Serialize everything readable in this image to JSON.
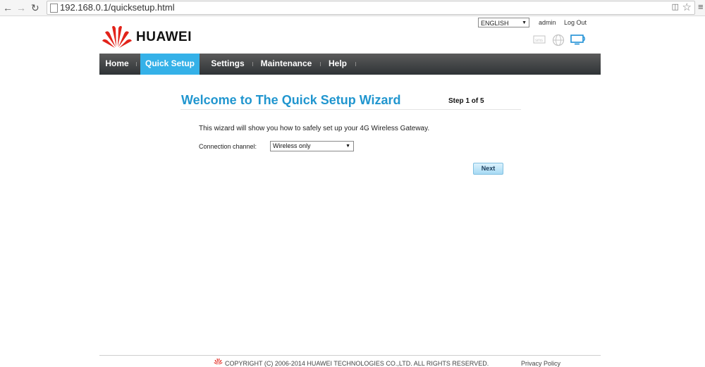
{
  "browser": {
    "back_icon": "arrow-left",
    "forward_icon": "arrow-right",
    "reload_icon": "reload",
    "url": "192.168.0.1/quicksetup.html",
    "menu_icon": "hamburger"
  },
  "header": {
    "language": "ENGLISH",
    "user": "admin",
    "logout": "Log Out",
    "brand": "HUAWEI",
    "brand_color": "#e2231a",
    "status_icons": [
      "sms-icon",
      "internet-globe-icon",
      "wifi-monitor-icon"
    ]
  },
  "nav": {
    "active_color": "#35b1e8",
    "items": [
      {
        "label": "Home",
        "active": false
      },
      {
        "label": "Quick Setup",
        "active": true
      },
      {
        "label": "Settings",
        "active": false
      },
      {
        "label": "Maintenance",
        "active": false
      },
      {
        "label": "Help",
        "active": false
      }
    ]
  },
  "main": {
    "title": "Welcome to The Quick Setup Wizard",
    "title_color": "#2196cf",
    "step": "Step 1 of 5",
    "intro": "This wizard will show you how to safely set up your 4G Wireless Gateway.",
    "channel_label": "Connection channel:",
    "channel_value": "Wireless only",
    "next_label": "Next"
  },
  "footer": {
    "copyright": "COPYRIGHT (C) 2006-2014 HUAWEI TECHNOLOGIES CO.,LTD. ALL RIGHTS RESERVED.",
    "privacy": "Privacy Policy"
  }
}
